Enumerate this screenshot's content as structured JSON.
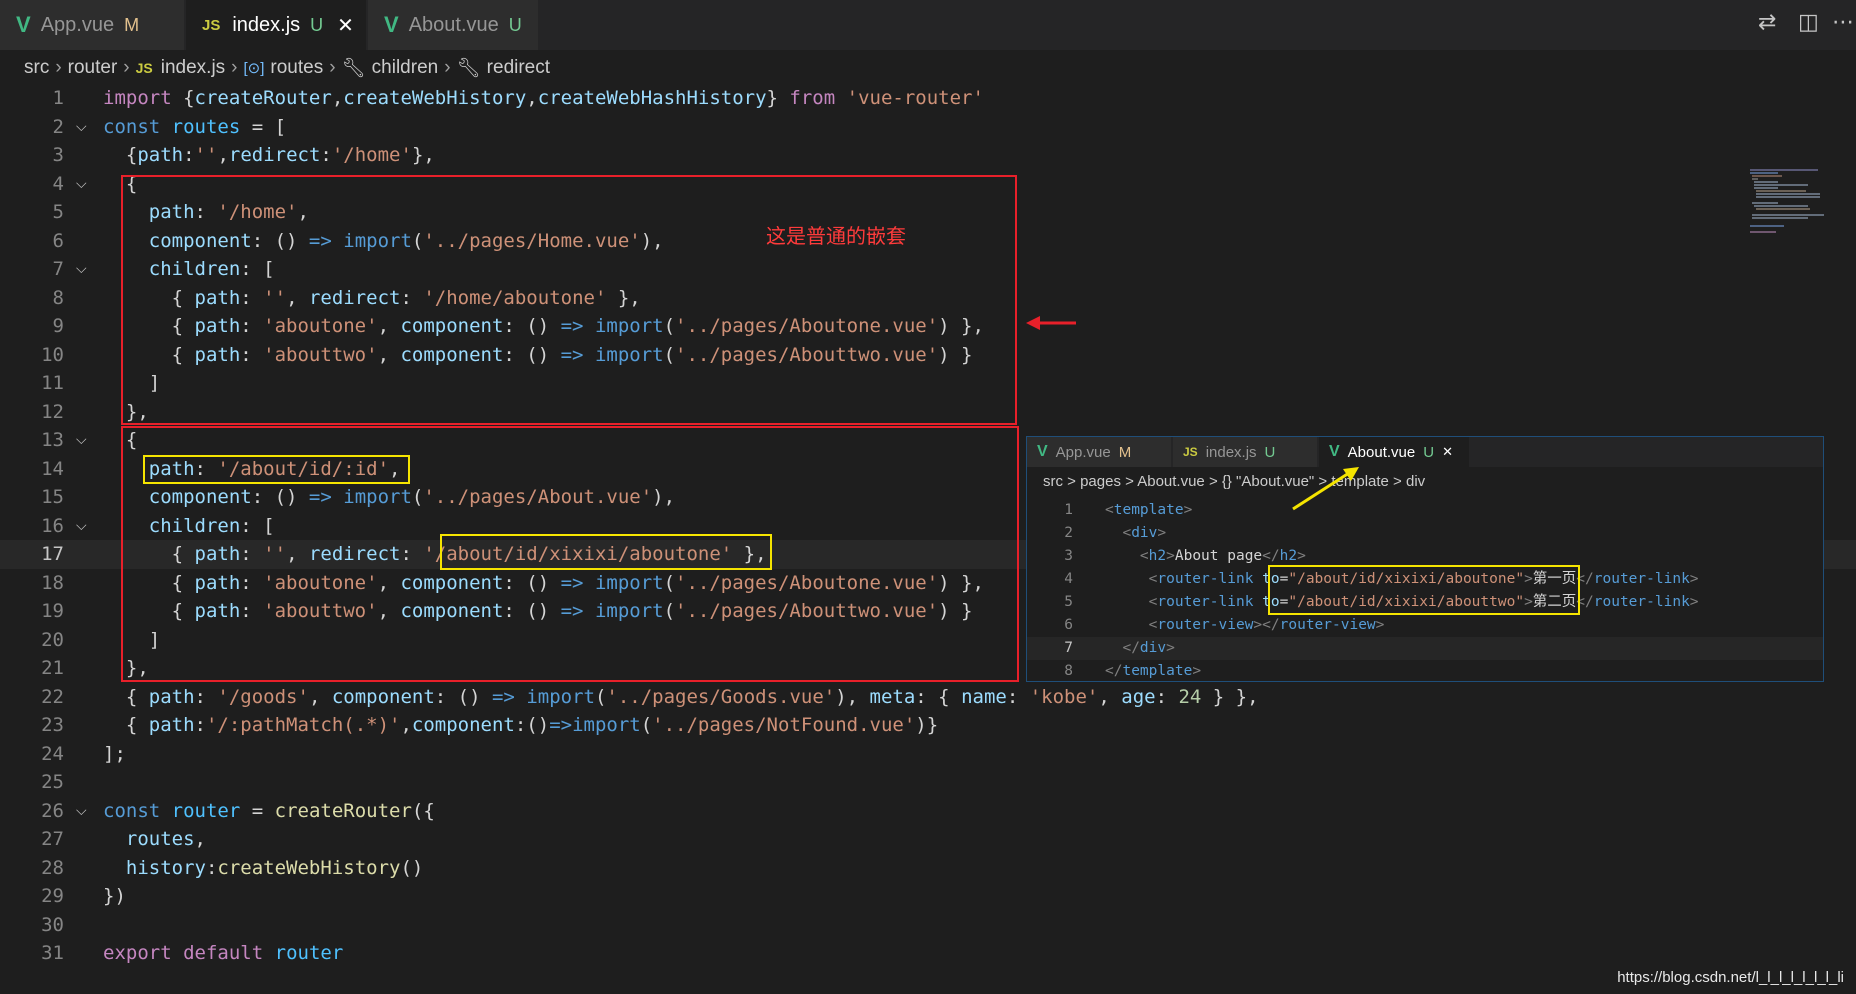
{
  "tabs": [
    {
      "name": "App.vue",
      "marker": "M",
      "type": "vue"
    },
    {
      "name": "index.js",
      "marker": "U",
      "type": "js"
    },
    {
      "name": "About.vue",
      "marker": "U",
      "type": "vue"
    }
  ],
  "icons": {
    "js": "JS",
    "vue": "V",
    "close": "✕"
  },
  "breadcrumb": [
    "src",
    "router",
    "index.js",
    "routes",
    "children",
    "redirect"
  ],
  "code": {
    "l1": {
      "n": "1",
      "a": "import",
      "b": " {",
      "c": "createRouter",
      "d": ",",
      "e": "createWebHistory",
      "f": ",",
      "g": "createWebHashHistory",
      "h": "} ",
      "i": "from",
      "j": " ",
      "k": "'vue-router'"
    },
    "l2": {
      "n": "2",
      "a": "const",
      "b": " ",
      "c": "routes",
      "d": " = ["
    },
    "l3": {
      "n": "3",
      "a": "  {",
      "b": "path",
      "c": ":",
      "d": "''",
      "e": ",",
      "f": "redirect",
      "g": ":",
      "h": "'/home'",
      "i": "},"
    },
    "l4": {
      "n": "4",
      "a": "  {"
    },
    "l5": {
      "n": "5",
      "a": "    ",
      "b": "path",
      "c": ": ",
      "d": "'/home'",
      "e": ","
    },
    "l6": {
      "n": "6",
      "a": "    ",
      "b": "component",
      "c": ": () ",
      "d": "=>",
      "e": " ",
      "f": "import",
      "g": "(",
      "h": "'../pages/Home.vue'",
      "i": "),"
    },
    "l7": {
      "n": "7",
      "a": "    ",
      "b": "children",
      "c": ": ["
    },
    "l8": {
      "n": "8",
      "a": "      { ",
      "b": "path",
      "c": ": ",
      "d": "''",
      "e": ", ",
      "f": "redirect",
      "g": ": ",
      "h": "'/home/aboutone'",
      "i": " },"
    },
    "l9": {
      "n": "9",
      "a": "      { ",
      "b": "path",
      "c": ": ",
      "d": "'aboutone'",
      "e": ", ",
      "f": "component",
      "g": ": () ",
      "h": "=>",
      "i": " ",
      "j": "import",
      "k": "(",
      "l": "'../pages/Aboutone.vue'",
      "m": ") },"
    },
    "l10": {
      "n": "10",
      "a": "      { ",
      "b": "path",
      "c": ": ",
      "d": "'abouttwo'",
      "e": ", ",
      "f": "component",
      "g": ": () ",
      "h": "=>",
      "i": " ",
      "j": "import",
      "k": "(",
      "l": "'../pages/Abouttwo.vue'",
      "m": ") }"
    },
    "l11": {
      "n": "11",
      "a": "    ]"
    },
    "l12": {
      "n": "12",
      "a": "  },"
    },
    "l13": {
      "n": "13",
      "a": "  {"
    },
    "l14": {
      "n": "14",
      "a": "    ",
      "b": "path",
      "c": ": ",
      "d": "'/about/id/:id'",
      "e": ","
    },
    "l15": {
      "n": "15",
      "a": "    ",
      "b": "component",
      "c": ": () ",
      "d": "=>",
      "e": " ",
      "f": "import",
      "g": "(",
      "h": "'../pages/About.vue'",
      "i": "),"
    },
    "l16": {
      "n": "16",
      "a": "    ",
      "b": "children",
      "c": ": ["
    },
    "l17": {
      "n": "17",
      "a": "      { ",
      "b": "path",
      "c": ": ",
      "d": "''",
      "e": ", ",
      "f": "redirect",
      "g": ": ",
      "h": "'/about/id/xixixi/aboutone'",
      "i": " },"
    },
    "l18": {
      "n": "18",
      "a": "      { ",
      "b": "path",
      "c": ": ",
      "d": "'aboutone'",
      "e": ", ",
      "f": "component",
      "g": ": () ",
      "h": "=>",
      "i": " ",
      "j": "import",
      "k": "(",
      "l": "'../pages/Aboutone.vue'",
      "m": ") },"
    },
    "l19": {
      "n": "19",
      "a": "      { ",
      "b": "path",
      "c": ": ",
      "d": "'abouttwo'",
      "e": ", ",
      "f": "component",
      "g": ": () ",
      "h": "=>",
      "i": " ",
      "j": "import",
      "k": "(",
      "l": "'../pages/Abouttwo.vue'",
      "m": ") }"
    },
    "l20": {
      "n": "20",
      "a": "    ]"
    },
    "l21": {
      "n": "21",
      "a": "  },"
    },
    "l22": {
      "n": "22",
      "a": "  { ",
      "b": "path",
      "c": ": ",
      "d": "'/goods'",
      "e": ", ",
      "f": "component",
      "g": ": () ",
      "h": "=>",
      "i": " ",
      "j": "import",
      "k": "(",
      "l": "'../pages/Goods.vue'",
      "m": "), ",
      "o": "meta",
      "p": ": { ",
      "q": "name",
      "r": ": ",
      "s": "'kobe'",
      "t": ", ",
      "u": "age",
      "v": ": ",
      "w": "24",
      "x": " } },"
    },
    "l23": {
      "n": "23",
      "a": "  { ",
      "b": "path",
      "c": ":",
      "d": "'/:pathMatch(.*)'",
      "e": ",",
      "f": "component",
      "g": ":()",
      "h": "=>",
      "i": "import",
      "j": "(",
      "k": "'../pages/NotFound.vue'",
      "l": ")}"
    },
    "l24": {
      "n": "24",
      "a": "];"
    },
    "l25": {
      "n": "25"
    },
    "l26": {
      "n": "26",
      "a": "const",
      "b": " ",
      "c": "router",
      "d": " = ",
      "e": "createRouter",
      "f": "({"
    },
    "l27": {
      "n": "27",
      "a": "  ",
      "b": "routes",
      "c": ","
    },
    "l28": {
      "n": "28",
      "a": "  ",
      "b": "history",
      "c": ":",
      "d": "createWebHistory",
      "e": "()"
    },
    "l29": {
      "n": "29",
      "a": "})"
    },
    "l30": {
      "n": "30"
    },
    "l31": {
      "n": "31",
      "a": "export",
      "b": " ",
      "c": "default",
      "d": " ",
      "e": "router"
    }
  },
  "annotation_text": "这是普通的嵌套",
  "overlay": {
    "tabs": [
      {
        "name": "App.vue",
        "marker": "M"
      },
      {
        "name": "index.js",
        "marker": "U"
      },
      {
        "name": "About.vue",
        "marker": "U"
      }
    ],
    "breadcrumb": "src > pages > About.vue > {} \"About.vue\" > template > div",
    "lines": [
      {
        "n": "1",
        "a": "<",
        "b": "template",
        "c": ">"
      },
      {
        "n": "2",
        "a": "  <",
        "b": "div",
        "c": ">"
      },
      {
        "n": "3",
        "a": "    <",
        "b": "h2",
        "c": ">",
        "d": "About page",
        "e": "</",
        "f": "h2",
        "g": ">"
      },
      {
        "n": "4",
        "a": "     <",
        "b": "router-link",
        "c": " ",
        "d": "to",
        "e": "=",
        "f": "\"/about/id/xixixi/aboutone\"",
        "g": ">",
        "h": "第一页",
        "i": "</",
        "j": "router-link",
        "k": ">"
      },
      {
        "n": "5",
        "a": "     <",
        "b": "router-link",
        "c": " ",
        "d": "to",
        "e": "=",
        "f": "\"/about/id/xixixi/abouttwo\"",
        "g": ">",
        "h": "第二页",
        "i": "</",
        "j": "router-link",
        "k": ">"
      },
      {
        "n": "6",
        "a": "     <",
        "b": "router-view",
        "c": "></",
        "d": "router-view",
        "e": ">"
      },
      {
        "n": "7",
        "a": "  </",
        "b": "div",
        "c": ">"
      },
      {
        "n": "8",
        "a": "</",
        "b": "template",
        "c": ">"
      }
    ]
  },
  "watermark": "https://blog.csdn.net/l_l_l_l_l_l_l_li",
  "colors": {
    "annotation_red": "#e8202a",
    "annotation_yellow": "#f5e400",
    "vue_green": "#41b883",
    "js_yellow": "#cbcb41"
  }
}
